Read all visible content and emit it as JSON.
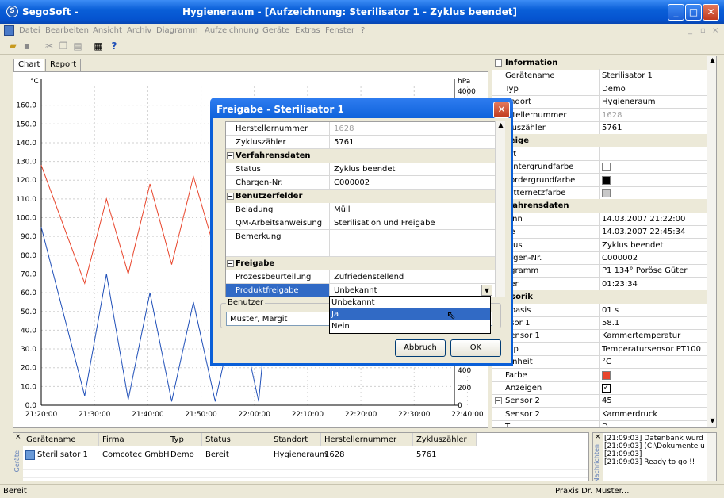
{
  "window": {
    "app_title": "SegoSoft -",
    "doc_title": "Hygieneraum - [Aufzeichnung: Sterilisator 1 - Zyklus beendet]",
    "app_icon_char": "S"
  },
  "menu": [
    "Datei",
    "Bearbeiten",
    "Ansicht",
    "Archiv",
    "Diagramm",
    "Aufzeichnung",
    "Geräte",
    "Extras",
    "Fenster",
    "?"
  ],
  "tabs": {
    "chart": "Chart",
    "report": "Report"
  },
  "chart_data": {
    "type": "line",
    "x_ticks": [
      "21:20:00",
      "21:30:00",
      "21:40:00",
      "21:50:00",
      "22:00:00",
      "22:10:00",
      "22:20:00",
      "22:30:00",
      "22:40:00"
    ],
    "y_left_unit": "°C",
    "y_left_ticks": [
      "0.0",
      "10.0",
      "20.0",
      "30.0",
      "40.0",
      "50.0",
      "60.0",
      "70.0",
      "80.0",
      "90.0",
      "100.0",
      "110.0",
      "120.0",
      "130.0",
      "140.0",
      "150.0",
      "160.0"
    ],
    "y_left_range": [
      0,
      170
    ],
    "y_right_unit": "hPa",
    "y_right_ticks_visible": [
      "0",
      "200",
      "400",
      "4000"
    ],
    "y_right_range": [
      0,
      4200
    ],
    "grid": true,
    "series": [
      {
        "color": "#e8452c",
        "axis": "left",
        "description": "temperature",
        "x": [
          0,
          4,
          6,
          8,
          10,
          12,
          14,
          16,
          18,
          20,
          22,
          23,
          26,
          28,
          30,
          32,
          34
        ],
        "y": [
          128,
          65,
          110,
          70,
          118,
          75,
          122,
          82,
          125,
          95,
          132,
          135,
          135,
          135,
          135,
          135,
          135
        ]
      },
      {
        "color": "#1f4fb8",
        "axis": "left",
        "description": "pressure",
        "x": [
          0,
          4,
          6,
          8,
          10,
          12,
          14,
          16,
          18,
          20,
          22,
          23,
          26,
          28,
          30,
          32,
          34
        ],
        "y": [
          95,
          5,
          70,
          3,
          60,
          2,
          55,
          2,
          55,
          2,
          125,
          130,
          130,
          130,
          130,
          130,
          130
        ]
      }
    ]
  },
  "dialog": {
    "title": "Freigabe - Sterilisator 1",
    "grid": [
      {
        "type": "row",
        "k": "Herstellernummer",
        "v": "1628",
        "grey": true
      },
      {
        "type": "row",
        "k": "Zykluszähler",
        "v": "5761"
      },
      {
        "type": "cat",
        "k": "Verfahrensdaten"
      },
      {
        "type": "row",
        "k": "Status",
        "v": "Zyklus beendet"
      },
      {
        "type": "row",
        "k": "Chargen-Nr.",
        "v": "C000002"
      },
      {
        "type": "cat",
        "k": "Benutzerfelder"
      },
      {
        "type": "row",
        "k": "Beladung",
        "v": "Müll"
      },
      {
        "type": "row",
        "k": "QM-Arbeitsanweisung",
        "v": "Sterilisation und Freigabe"
      },
      {
        "type": "row",
        "k": "Bemerkung",
        "v": ""
      },
      {
        "type": "row",
        "k": "",
        "v": ""
      },
      {
        "type": "cat",
        "k": "Freigabe"
      },
      {
        "type": "row",
        "k": "Prozessbeurteilung",
        "v": "Zufriedenstellend"
      },
      {
        "type": "row",
        "k": "Produktfreigabe",
        "v": "Unbekannt",
        "selected": true
      }
    ],
    "dropdown_options": [
      "Unbekannt",
      "Ja",
      "Nein"
    ],
    "dropdown_selected": "Ja",
    "benutzer_label": "Benutzer",
    "benutzer_value": "Muster, Margit",
    "cancel_label": "Abbruch",
    "ok_label": "OK"
  },
  "info_panel": [
    {
      "type": "cat",
      "k": "Information"
    },
    {
      "type": "row",
      "k": "Gerätename",
      "v": "Sterilisator 1"
    },
    {
      "type": "row",
      "k": "Typ",
      "v": "Demo"
    },
    {
      "type": "row",
      "k": "andort",
      "v": "Hygieneraum"
    },
    {
      "type": "row",
      "k": "rstellernummer",
      "v": "1628",
      "grey": true
    },
    {
      "type": "row",
      "k": "kluszähler",
      "v": "5761"
    },
    {
      "type": "cat",
      "k": "zeige"
    },
    {
      "type": "row",
      "k": "art",
      "v": ""
    },
    {
      "type": "row",
      "k": "Hintergrundfarbe",
      "v": "",
      "swatch": "#ffffff"
    },
    {
      "type": "row",
      "k": "Vordergrundfarbe",
      "v": "",
      "swatch": "#000000"
    },
    {
      "type": "row",
      "k": "Gitternetzfarbe",
      "v": "",
      "swatch": "#c8c8c8"
    },
    {
      "type": "cat",
      "k": "rfahrensdaten"
    },
    {
      "type": "row",
      "k": "ginn",
      "v": "14.03.2007 21:22:00"
    },
    {
      "type": "row",
      "k": "de",
      "v": "14.03.2007 22:45:34"
    },
    {
      "type": "row",
      "k": "atus",
      "v": "Zyklus beendet"
    },
    {
      "type": "row",
      "k": "argen-Nr.",
      "v": "C000002"
    },
    {
      "type": "row",
      "k": "ogramm",
      "v": "P1 134° Poröse Güter"
    },
    {
      "type": "row",
      "k": "uer",
      "v": "01:23:34"
    },
    {
      "type": "cat",
      "k": "nsorik"
    },
    {
      "type": "row",
      "k": "itbasis",
      "v": "01 s"
    },
    {
      "type": "row",
      "k": "nsor 1",
      "v": "58.1"
    },
    {
      "type": "row",
      "k": "Sensor 1",
      "v": "Kammertemperatur"
    },
    {
      "type": "row",
      "k": "Typ",
      "v": "Temperatursensor PT100"
    },
    {
      "type": "row",
      "k": "Einheit",
      "v": "°C"
    },
    {
      "type": "row",
      "k": "Farbe",
      "v": "",
      "swatch": "#e8452c"
    },
    {
      "type": "row",
      "k": "Anzeigen",
      "v": "",
      "check": true
    },
    {
      "type": "row",
      "k": "Sensor 2",
      "v": "45",
      "toggle": true
    },
    {
      "type": "row",
      "k": "Sensor 2",
      "v": "Kammerdruck"
    },
    {
      "type": "row",
      "k": "T",
      "v": "D"
    }
  ],
  "device_table": {
    "side_label": "Geräte",
    "columns": [
      "Gerätename",
      "Firma",
      "Typ",
      "Status",
      "Standort",
      "Herstellernummer",
      "Zykluszähler"
    ],
    "rows": [
      [
        "Sterilisator 1",
        "Comcotec GmbH",
        "Demo",
        "Bereit",
        "Hygieneraum",
        "1628",
        "5761"
      ]
    ]
  },
  "log": {
    "side_label": "Nachrichten",
    "lines": [
      "[21:09:03]  Datenbank wurd",
      "[21:09:03]  (C:\\Dokumente u",
      "[21:09:03]",
      "[21:09:03]  Ready to go !!"
    ]
  },
  "status": {
    "left": "Bereit",
    "right": "Praxis Dr. Muster..."
  }
}
